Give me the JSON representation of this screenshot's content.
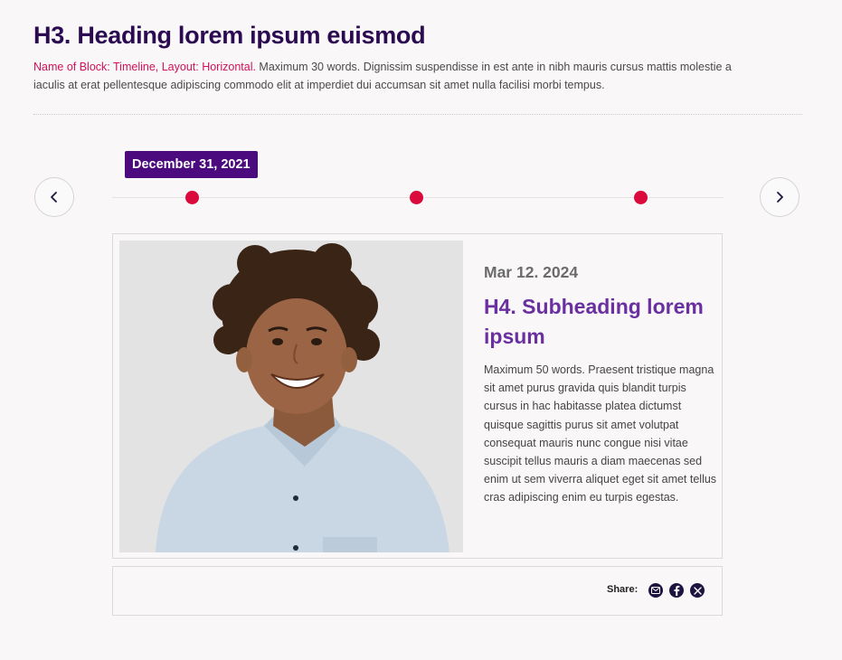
{
  "header": {
    "title": "H3. Heading lorem ipsum euismod",
    "meta_label": "Name of Block: Timeline, Layout: Horizontal.",
    "intro_text": " Maximum 30 words. Dignissim suspendisse in est ante in nibh mauris cursus mattis molestie a iaculis at erat pellentesque adipiscing commodo elit at imperdiet dui accumsan sit amet nulla facilisi morbi tempus."
  },
  "timeline": {
    "active_date": "December 31, 2021",
    "dot_count": 3
  },
  "card": {
    "date": "Mar 12. 2024",
    "title": "H4. Subheading lorem ipsum",
    "body": "Maximum 50 words. Praesent tristique magna sit amet purus gravida quis blandit turpis cursus in hac habitasse platea dictumst quisque sagittis purus sit amet volutpat consequat mauris nunc congue nisi vitae suscipit tellus mauris a diam maecenas sed enim ut sem viverra aliquet eget sit amet tellus cras adipiscing enim eu turpis egestas."
  },
  "share": {
    "label": "Share:",
    "icons": [
      "email-icon",
      "facebook-icon",
      "x-icon"
    ]
  },
  "colors": {
    "heading": "#2c0a52",
    "accent": "#d0115a",
    "date_tag_bg": "#4b0a7e",
    "dot": "#db0a3c",
    "subheading": "#6a2fa0"
  }
}
